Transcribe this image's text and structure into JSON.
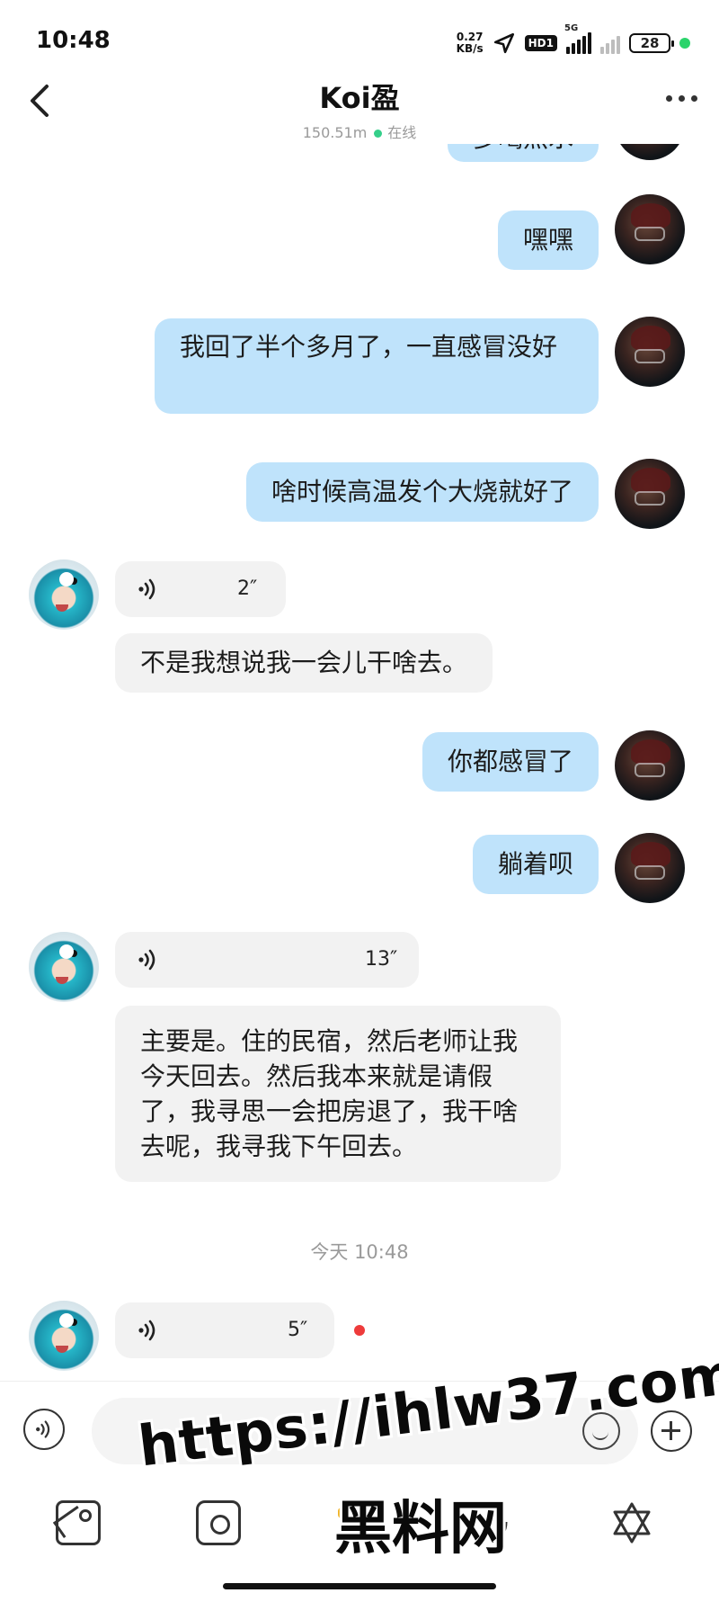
{
  "status_bar": {
    "time": "10:48",
    "net_speed_value": "0.27",
    "net_speed_unit": "KB/s",
    "hd_label": "HD1",
    "network_label": "5G",
    "battery": "28"
  },
  "header": {
    "name": "Koi盈",
    "distance": "150.51m",
    "status": "在线"
  },
  "messages": {
    "m0": "多喝热水",
    "m1": "嘿嘿",
    "m2": "我回了半个多月了，一直感冒没好",
    "m3": "啥时候高温发个大烧就好了",
    "v1": "2″",
    "m4": "不是我想说我一会儿干啥去。",
    "m5": "你都感冒了",
    "m6": "躺着呗",
    "v2": "13″",
    "m7": "主要是。住的民宿，然后老师让我今天回去。然后我本来就是请假了，我寻思一会把房退了，我干啥去呢，我寻我下午回去。",
    "timestamp": "今天 10:48",
    "v3": "5″"
  },
  "input": {
    "placeholder": ""
  },
  "watermark": {
    "url": "https://ihlw37.com",
    "site": "黑料网"
  }
}
